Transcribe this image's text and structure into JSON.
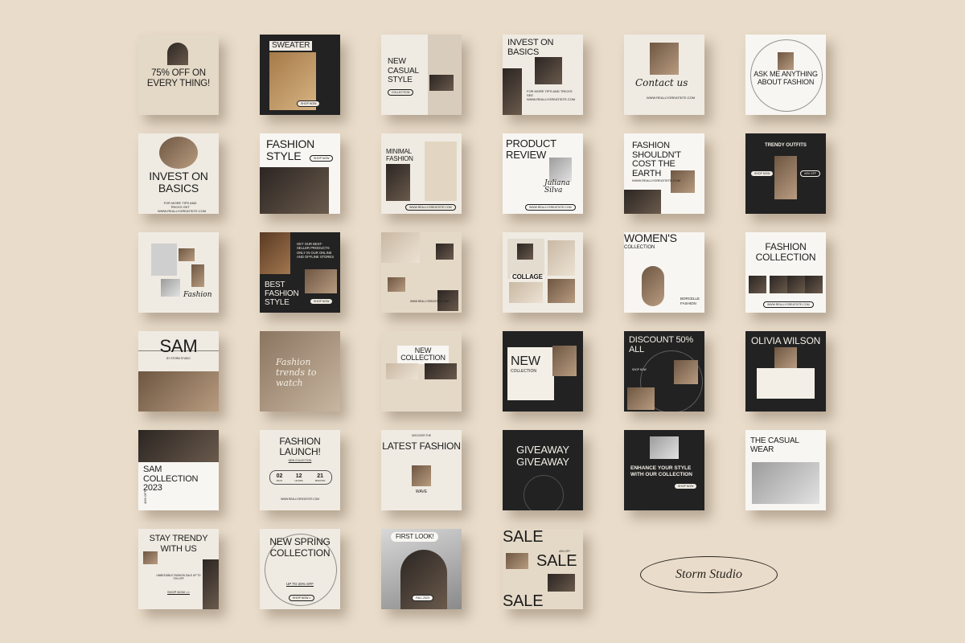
{
  "brand": "Storm Studio",
  "tiles": {
    "t1": {
      "headline": "75% OFF ON EVERY THING!"
    },
    "t2": {
      "headline": "SWEATER",
      "button": "SHOP NOW"
    },
    "t3": {
      "headline": "NEW CASUAL STYLE",
      "button": "COLLECTION"
    },
    "t4": {
      "headline": "INVEST ON BASICS",
      "caption": "FOR MORE TIPS AND TRICKS SEE WWW.REALLYGREATSITE.COM"
    },
    "t5": {
      "headline": "Contact us",
      "caption": "WWW.REALLYGREATSITE.COM"
    },
    "t6": {
      "headline": "ASK ME ANYTHING ABOUT FASHION"
    },
    "t7": {
      "headline": "INVEST ON BASICS",
      "caption": "FOR MORE TIPS AND TRICKS GET WWW.REALLYGREATSITE.COM"
    },
    "t8": {
      "headline": "FASHION STYLE",
      "button": "SHOP NOW"
    },
    "t9": {
      "headline": "MINIMAL FASHION",
      "caption": "WWW.REALLYGREATSITE.COM"
    },
    "t10": {
      "headline": "PRODUCT REVIEW",
      "script": "Juliana Silva",
      "caption": "WWW.REALLYGREATSITE.COM"
    },
    "t11": {
      "headline": "FASHION SHOULDN'T COST THE EARTH",
      "caption": "WWW.REALLYGREATSITE.COM"
    },
    "t12": {
      "headline": "TRENDY OUTFITS",
      "button1": "SHOP NOW",
      "button2": "40% OFF"
    },
    "t13": {
      "script": "Fashion"
    },
    "t14": {
      "headline": "BEST FASHION STYLE",
      "body": "GET OUR BEST-SELLER PRODUCTS ONLY IN OUR ONLINE AND OFFLINE STORES",
      "button": "SHOP NOW"
    },
    "t15": {
      "caption": "WWW.REALLYGREATSITE.COM"
    },
    "t16": {
      "headline": "COLLAGE"
    },
    "t17": {
      "headline": "WOMEN'S",
      "sub": "COLLECTION",
      "caption": "BORCELLE FASHION"
    },
    "t18": {
      "headline": "FASHION COLLECTION",
      "caption": "WWW.REALLYGREATSITE.COM"
    },
    "t19": {
      "headline": "SAM",
      "sub": "BY STORM STUDIO"
    },
    "t20": {
      "script": "Fashion trends to watch"
    },
    "t21": {
      "headline": "NEW COLLECTION"
    },
    "t22": {
      "headline": "NEW",
      "sub": "COLLECTION"
    },
    "t23": {
      "headline": "DISCOUNT 50% ALL",
      "caption": "SHOP NOW"
    },
    "t24": {
      "headline": "OLIVIA WILSON"
    },
    "t25": {
      "headline": "SAM COLLECTION 2023",
      "side": "40% OFF"
    },
    "t26": {
      "headline": "FASHION LAUNCH!",
      "sub": "NEW COLLECTION",
      "days": "02",
      "hours": "12",
      "minutes": "21",
      "days_label": "DAYS",
      "hours_label": "HOURS",
      "minutes_label": "MINUTES",
      "caption": "WWW.REALLYGREATSITE.COM"
    },
    "t27": {
      "headline": "LATEST FASHION",
      "sub": "WAVE",
      "top": "DISCOVER THE"
    },
    "t28": {
      "headline": "GIVEAWAY GIVEAWAY"
    },
    "t29": {
      "headline": "ENHANCE YOUR STYLE WITH OUR COLLECTION",
      "button": "SHOP NOW"
    },
    "t30": {
      "headline": "THE CASUAL WEAR"
    },
    "t31": {
      "headline": "STAY TRENDY WITH US",
      "body": "UNBEATABLE FASHION SALE UP TO 70% OFF",
      "button": "SHOP NOW >>"
    },
    "t32": {
      "headline": "NEW SPRING COLLECTION",
      "sub": "UP TO 20% OFF",
      "button": "SHOP NOW >"
    },
    "t33": {
      "headline": "FIRST LOOK!",
      "button": "FALL 2023"
    },
    "t34": {
      "line1": "SALE",
      "line2": "SALE",
      "line3": "SALE",
      "badge": "40% OFF"
    }
  }
}
